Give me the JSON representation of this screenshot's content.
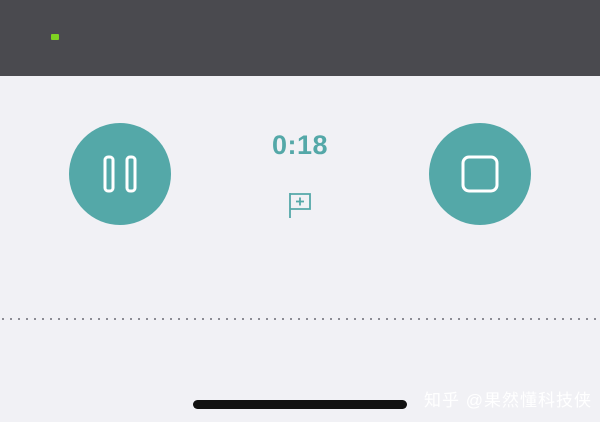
{
  "status_bar": {
    "indicator_color": "#7ed321"
  },
  "recorder": {
    "elapsed": "0:18",
    "pause_icon": "pause-icon",
    "stop_icon": "stop-icon",
    "flag_icon": "add-marker-flag-icon",
    "accent_color": "#54a8a8"
  },
  "watermark": {
    "text": "知乎 @果然懂科技侠"
  }
}
